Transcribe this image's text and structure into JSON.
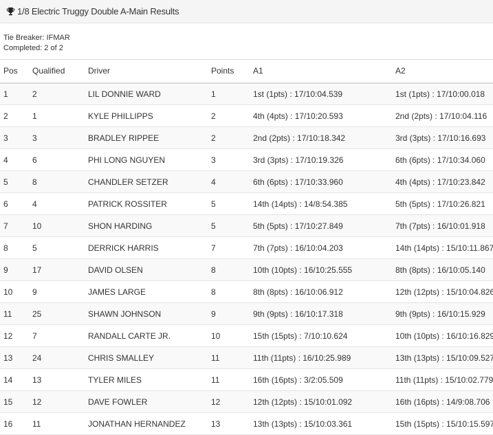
{
  "header": {
    "title": "1/8 Electric Truggy Double A-Main Results",
    "icon": "trophy-icon"
  },
  "meta": {
    "tie_breaker": "Tie Breaker: IFMAR",
    "completed": "Completed: 2 of 2"
  },
  "table": {
    "columns": [
      "Pos",
      "Qualified",
      "Driver",
      "Points",
      "A1",
      "A2"
    ],
    "rows": [
      {
        "pos": "1",
        "qualified": "2",
        "driver": "LIL DONNIE WARD",
        "points": "1",
        "a1": "1st (1pts) : 17/10:04.539",
        "a2": "1st (1pts) : 17/10:00.018"
      },
      {
        "pos": "2",
        "qualified": "1",
        "driver": "KYLE PHILLIPPS",
        "points": "2",
        "a1": "4th (4pts) : 17/10:20.593",
        "a2": "2nd (2pts) : 17/10:04.116"
      },
      {
        "pos": "3",
        "qualified": "3",
        "driver": "BRADLEY RIPPEE",
        "points": "2",
        "a1": "2nd (2pts) : 17/10:18.342",
        "a2": "3rd (3pts) : 17/10:16.693"
      },
      {
        "pos": "4",
        "qualified": "6",
        "driver": "PHI LONG NGUYEN",
        "points": "3",
        "a1": "3rd (3pts) : 17/10:19.326",
        "a2": "6th (6pts) : 17/10:34.060"
      },
      {
        "pos": "5",
        "qualified": "8",
        "driver": "CHANDLER SETZER",
        "points": "4",
        "a1": "6th (6pts) : 17/10:33.960",
        "a2": "4th (4pts) : 17/10:23.842"
      },
      {
        "pos": "6",
        "qualified": "4",
        "driver": "PATRICK ROSSITER",
        "points": "5",
        "a1": "14th (14pts) : 14/8:54.385",
        "a2": "5th (5pts) : 17/10:26.821"
      },
      {
        "pos": "7",
        "qualified": "10",
        "driver": "SHON HARDING",
        "points": "5",
        "a1": "5th (5pts) : 17/10:27.849",
        "a2": "7th (7pts) : 16/10:01.918"
      },
      {
        "pos": "8",
        "qualified": "5",
        "driver": "DERRICK HARRIS",
        "points": "7",
        "a1": "7th (7pts) : 16/10:04.203",
        "a2": "14th (14pts) : 15/10:11.867"
      },
      {
        "pos": "9",
        "qualified": "17",
        "driver": "DAVID OLSEN",
        "points": "8",
        "a1": "10th (10pts) : 16/10:25.555",
        "a2": "8th (8pts) : 16/10:05.140"
      },
      {
        "pos": "10",
        "qualified": "9",
        "driver": "JAMES LARGE",
        "points": "8",
        "a1": "8th (8pts) : 16/10:06.912",
        "a2": "12th (12pts) : 15/10:04.826"
      },
      {
        "pos": "11",
        "qualified": "25",
        "driver": "SHAWN JOHNSON",
        "points": "9",
        "a1": "9th (9pts) : 16/10:17.318",
        "a2": "9th (9pts) : 16/10:15.929"
      },
      {
        "pos": "12",
        "qualified": "7",
        "driver": "RANDALL CARTE JR.",
        "points": "10",
        "a1": "15th (15pts) : 7/10:10.624",
        "a2": "10th (10pts) : 16/10:16.829"
      },
      {
        "pos": "13",
        "qualified": "24",
        "driver": "CHRIS SMALLEY",
        "points": "11",
        "a1": "11th (11pts) : 16/10:25.989",
        "a2": "13th (13pts) : 15/10:09.527"
      },
      {
        "pos": "14",
        "qualified": "13",
        "driver": "TYLER MILES",
        "points": "11",
        "a1": "16th (16pts) : 3/2:05.509",
        "a2": "11th (11pts) : 15/10:02.779"
      },
      {
        "pos": "15",
        "qualified": "12",
        "driver": "DAVE FOWLER",
        "points": "12",
        "a1": "12th (12pts) : 15/10:01.092",
        "a2": "16th (16pts) : 14/9:08.706"
      },
      {
        "pos": "16",
        "qualified": "11",
        "driver": "JONATHAN HERNANDEZ",
        "points": "13",
        "a1": "13th (13pts) : 15/10:03.361",
        "a2": "15th (15pts) : 15/10:15.597"
      }
    ]
  }
}
